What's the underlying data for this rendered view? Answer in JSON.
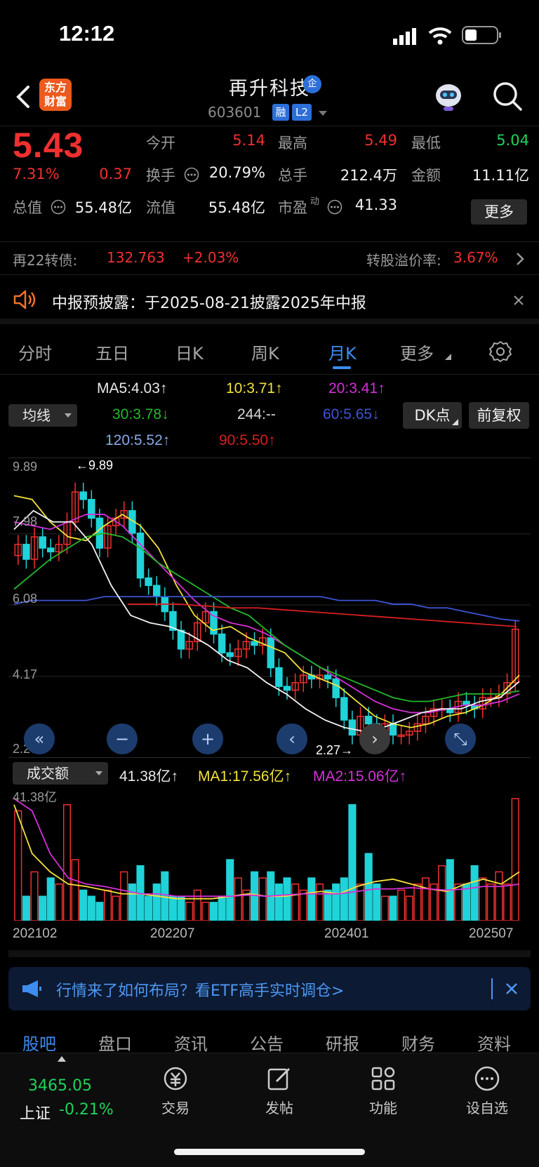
{
  "status_bar": {
    "time": "12:12"
  },
  "header": {
    "brand_line1": "东方",
    "brand_line2": "财富",
    "stock_name": "再升科技",
    "name_badge": "企",
    "stock_code": "603601",
    "tag_margin": "融",
    "tag_level": "L2"
  },
  "quote": {
    "price": "5.43",
    "change_pct": "7.31%",
    "change": "0.37",
    "open_label": "今开",
    "open": "5.14",
    "high_label": "最高",
    "high": "5.49",
    "low_label": "最低",
    "low": "5.04",
    "turnover_label": "换手",
    "turnover": "20.79%",
    "volume_label": "总手",
    "volume": "212.4万",
    "amount_label": "金额",
    "amount": "11.11亿",
    "mcap_label": "总值",
    "mcap": "55.48亿",
    "float_label": "流值",
    "float_cap": "55.48亿",
    "pe_label": "市盈",
    "pe_sup": "动",
    "pe": "41.33",
    "more_button": "更多"
  },
  "bond": {
    "name": "再22转债:",
    "price": "132.763",
    "change": "+2.03%",
    "premium_label": "转股溢价率:",
    "premium": "3.67%"
  },
  "notice": {
    "text": "中报预披露：于2025-08-21披露2025年中报"
  },
  "period_tabs": [
    "分时",
    "五日",
    "日K",
    "周K",
    "月K",
    "更多"
  ],
  "ma_legend": {
    "ma5": "MA5:4.03↑",
    "ma10": "10:3.71↑",
    "ma20": "20:3.41↑",
    "ma30": "30:3.78↓",
    "ma244": "244:--",
    "ma60": "60:5.65↓",
    "ma120": "120:5.52↑",
    "ma90": "90:5.50↑",
    "dropdown": "均线",
    "dk_button": "DK点",
    "adjust_button": "前复权"
  },
  "chart_labels": {
    "y_top": "9.89",
    "y_mid1": "7.98",
    "y_mid2": "6.08",
    "y_mid3": "4.17",
    "y_bottom": "2.27",
    "max_marker": "←9.89",
    "min_marker": "2.27→",
    "x_labels": [
      "202102",
      "202207",
      "202401",
      "202507"
    ]
  },
  "volume_legend": {
    "dropdown": "成交额",
    "value": "41.38亿↑",
    "ma1": "MA1:17.56亿↑",
    "ma2": "MA2:15.06亿↑",
    "y_top": "41.38亿"
  },
  "ad": {
    "text": "行情来了如何布局？看ETF高手实时调仓>"
  },
  "bottom_tabs": [
    "股吧",
    "盘口",
    "资讯",
    "公告",
    "研报",
    "财务",
    "资料"
  ],
  "bottom_nav": {
    "index_value": "3465.05",
    "index_name": "上证",
    "index_change": "-0.21%",
    "items": [
      "交易",
      "发帖",
      "功能",
      "设自选"
    ]
  },
  "chart_data": {
    "type": "candlestick",
    "y_range": [
      2.27,
      9.89
    ],
    "x_labels": [
      "202102",
      "202207",
      "202401",
      "202507"
    ],
    "last_close": 5.43,
    "high_marker": 9.89,
    "low_marker": 2.27,
    "ma": {
      "MA5": 4.03,
      "MA10": 3.71,
      "MA20": 3.41,
      "MA30": 3.78,
      "MA60": 5.65,
      "MA120": 5.52,
      "MA90": 5.5
    },
    "volume": {
      "last": "41.38亿",
      "MA1": "17.56亿",
      "MA2": "15.06亿"
    }
  },
  "colors": {
    "up": "#f0302f",
    "down": "#1fd3d8",
    "accent": "#3d8cf0"
  }
}
